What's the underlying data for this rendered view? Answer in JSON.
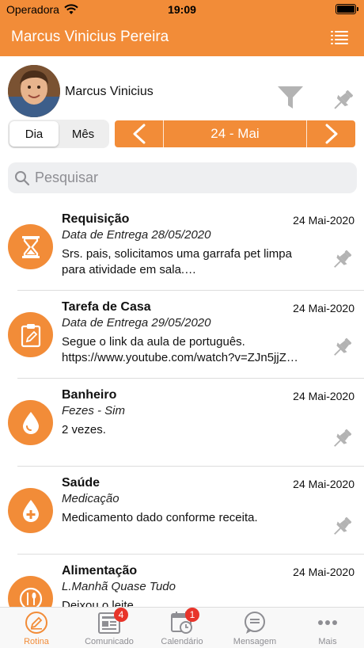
{
  "status_bar": {
    "carrier": "Operadora",
    "time": "19:09"
  },
  "nav": {
    "title": "Marcus Vinicius Pereira"
  },
  "profile": {
    "name": "Marcus Vinicius"
  },
  "segmented": {
    "day": "Dia",
    "month": "Mês",
    "selected": "Dia"
  },
  "date": {
    "label": "24 - Mai"
  },
  "search": {
    "placeholder": "Pesquisar",
    "value": ""
  },
  "items": [
    {
      "title": "Requisição",
      "date": "24 Mai-2020",
      "subtitle": "Data de Entrega 28/05/2020",
      "body": "Srs. pais, solicitamos uma garrafa pet limpa\npara atividade em sala.…",
      "icon": "hourglass-icon"
    },
    {
      "title": "Tarefa de Casa",
      "date": "24 Mai-2020",
      "subtitle": "Data de Entrega 29/05/2020",
      "body": "Segue o link da aula de português.\nhttps://www.youtube.com/watch?v=ZJn5jjZ…",
      "icon": "clipboard-icon"
    },
    {
      "title": "Banheiro",
      "date": "24 Mai-2020",
      "subtitle": "Fezes - Sim",
      "body": "2 vezes.",
      "icon": "drop-icon"
    },
    {
      "title": "Saúde",
      "date": "24 Mai-2020",
      "subtitle": "Medicação",
      "body": "Medicamento dado conforme receita.",
      "icon": "health-drop-icon"
    },
    {
      "title": "Alimentação",
      "date": "24 Mai-2020",
      "subtitle": "L.Manhã Quase Tudo",
      "body": "Deixou o leite",
      "icon": "cutlery-icon"
    }
  ],
  "tabs": [
    {
      "label": "Rotina",
      "active": true,
      "badge": ""
    },
    {
      "label": "Comunicado",
      "active": false,
      "badge": "4"
    },
    {
      "label": "Calendário",
      "active": false,
      "badge": "1"
    },
    {
      "label": "Mensagem",
      "active": false,
      "badge": ""
    },
    {
      "label": "Mais",
      "active": false,
      "badge": ""
    }
  ],
  "colors": {
    "accent": "#F28C38",
    "badge": "#E8342A"
  }
}
